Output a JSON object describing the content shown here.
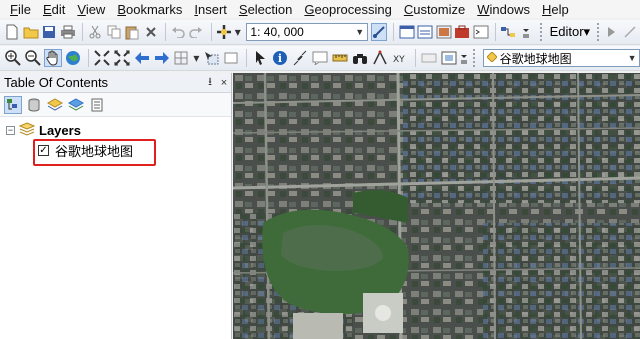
{
  "menu": {
    "items": [
      "File",
      "Edit",
      "View",
      "Bookmarks",
      "Insert",
      "Selection",
      "Geoprocessing",
      "Customize",
      "Windows",
      "Help"
    ]
  },
  "toolbar": {
    "scale_value": "1: 40, 000",
    "editor_label": "Editor▾",
    "layer_combo_value": "谷歌地球地图"
  },
  "toc": {
    "title": "Table Of Contents",
    "pin_glyph": "⭳",
    "close_glyph": "×",
    "group_label": "Layers",
    "group_expander": "−",
    "layer_label": "谷歌地球地图",
    "layer_checked_glyph": "✓"
  },
  "colors": {
    "highlight_border": "#e0201c",
    "map_vegetation": "#3f6b3a",
    "map_water": "#4e6e4b"
  }
}
